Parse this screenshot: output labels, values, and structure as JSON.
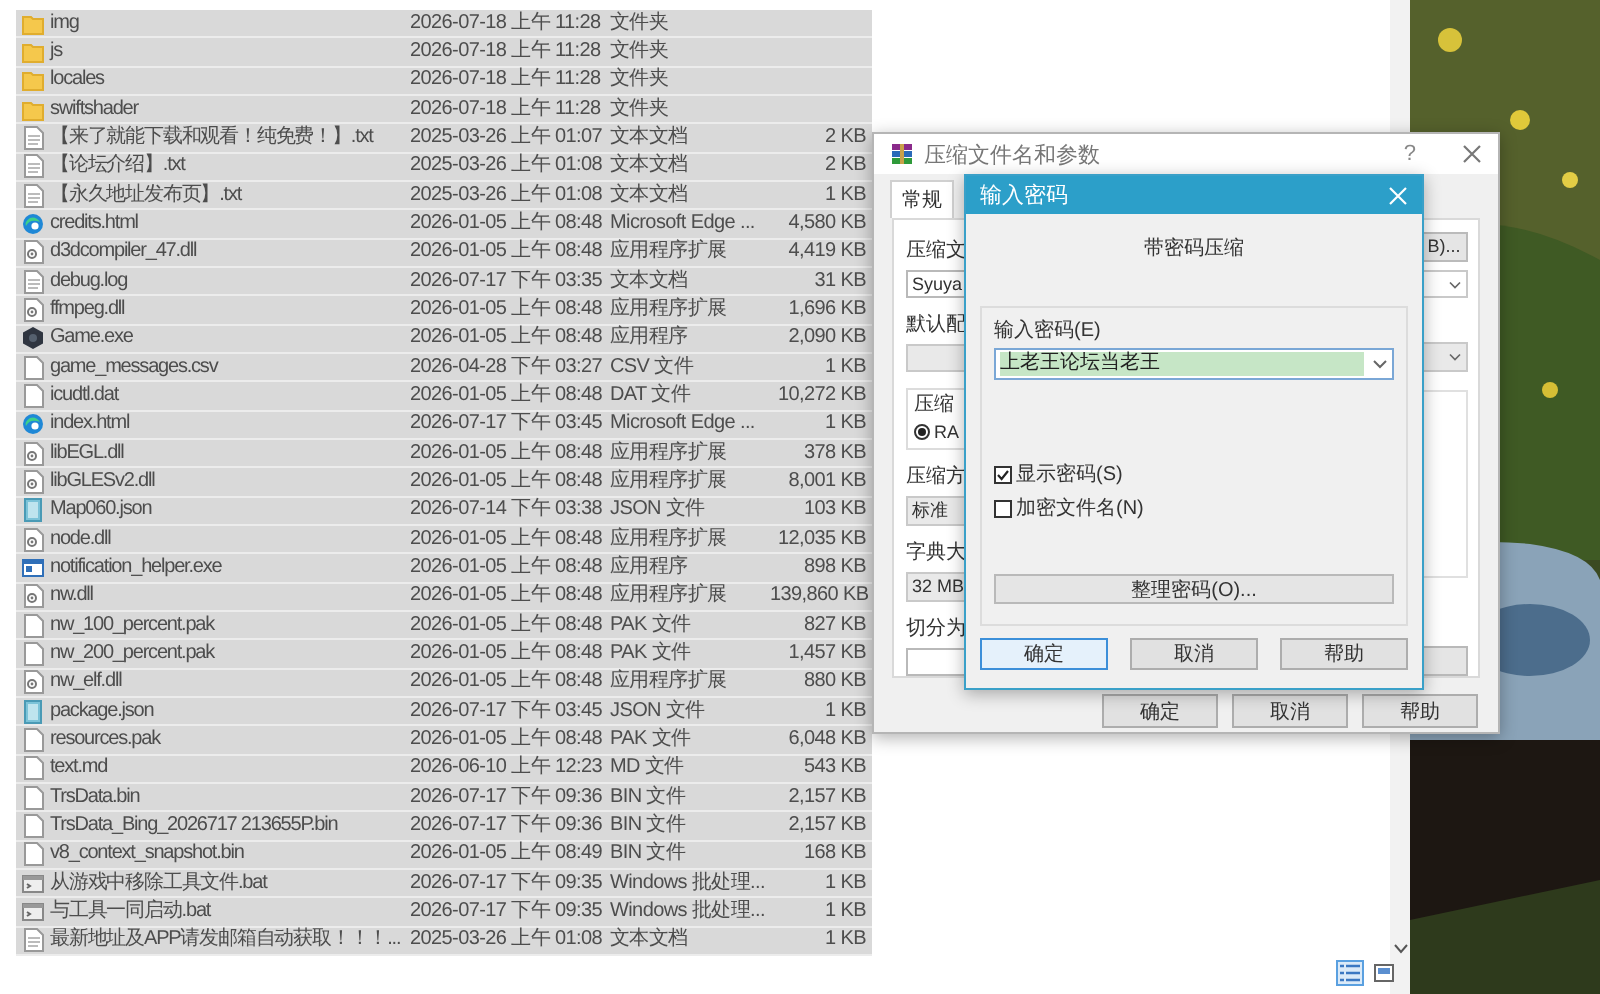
{
  "explorer": {
    "files": [
      {
        "name": "img",
        "date": "2026-07-18 上午 11:28",
        "type": "文件夹",
        "kind": "folder"
      },
      {
        "name": "js",
        "date": "2026-07-18 上午 11:28",
        "type": "文件夹",
        "kind": "folder"
      },
      {
        "name": "locales",
        "date": "2026-07-18 上午 11:28",
        "type": "文件夹",
        "kind": "folder"
      },
      {
        "name": "swiftshader",
        "date": "2026-07-18 上午 11:28",
        "type": "文件夹",
        "kind": "folder"
      },
      {
        "name": "【来了就能下载和观看！纯免费！】.txt",
        "date": "2025-03-26 上午 01:07",
        "type": "文本文档",
        "size": "2 KB",
        "kind": "text"
      },
      {
        "name": "【论坛介绍】.txt",
        "date": "2025-03-26 上午 01:08",
        "type": "文本文档",
        "size": "2 KB",
        "kind": "text"
      },
      {
        "name": "【永久地址发布页】.txt",
        "date": "2025-03-26 上午 01:08",
        "type": "文本文档",
        "size": "1 KB",
        "kind": "text"
      },
      {
        "name": "credits.html",
        "date": "2026-01-05 上午 08:48",
        "type": "Microsoft Edge ...",
        "size": "4,580 KB",
        "kind": "browser"
      },
      {
        "name": "d3dcompiler_47.dll",
        "date": "2026-01-05 上午 08:48",
        "type": "应用程序扩展",
        "size": "4,419 KB",
        "kind": "dll"
      },
      {
        "name": "debug.log",
        "date": "2026-07-17 下午 03:35",
        "type": "文本文档",
        "size": "31 KB",
        "kind": "text"
      },
      {
        "name": "ffmpeg.dll",
        "date": "2026-01-05 上午 08:48",
        "type": "应用程序扩展",
        "size": "1,696 KB",
        "kind": "dll"
      },
      {
        "name": "Game.exe",
        "date": "2026-01-05 上午 08:48",
        "type": "应用程序",
        "size": "2,090 KB",
        "kind": "hexagon"
      },
      {
        "name": "game_messages.csv",
        "date": "2026-04-28 下午 03:27",
        "type": "CSV 文件",
        "size": "1 KB",
        "kind": "blank"
      },
      {
        "name": "icudtl.dat",
        "date": "2026-01-05 上午 08:48",
        "type": "DAT 文件",
        "size": "10,272 KB",
        "kind": "blank"
      },
      {
        "name": "index.html",
        "date": "2026-07-17 下午 03:45",
        "type": "Microsoft Edge ...",
        "size": "1 KB",
        "kind": "browser"
      },
      {
        "name": "libEGL.dll",
        "date": "2026-01-05 上午 08:48",
        "type": "应用程序扩展",
        "size": "378 KB",
        "kind": "dll"
      },
      {
        "name": "libGLESv2.dll",
        "date": "2026-01-05 上午 08:48",
        "type": "应用程序扩展",
        "size": "8,001 KB",
        "kind": "dll"
      },
      {
        "name": "Map060.json",
        "date": "2026-07-14 下午 03:38",
        "type": "JSON 文件",
        "size": "103 KB",
        "kind": "data"
      },
      {
        "name": "node.dll",
        "date": "2026-01-05 上午 08:48",
        "type": "应用程序扩展",
        "size": "12,035 KB",
        "kind": "dll"
      },
      {
        "name": "notification_helper.exe",
        "date": "2026-01-05 上午 08:48",
        "type": "应用程序",
        "size": "898 KB",
        "kind": "app"
      },
      {
        "name": "nw.dll",
        "date": "2026-01-05 上午 08:48",
        "type": "应用程序扩展",
        "size": "139,860 KB",
        "kind": "dll"
      },
      {
        "name": "nw_100_percent.pak",
        "date": "2026-01-05 上午 08:48",
        "type": "PAK 文件",
        "size": "827 KB",
        "kind": "blank"
      },
      {
        "name": "nw_200_percent.pak",
        "date": "2026-01-05 上午 08:48",
        "type": "PAK 文件",
        "size": "1,457 KB",
        "kind": "blank"
      },
      {
        "name": "nw_elf.dll",
        "date": "2026-01-05 上午 08:48",
        "type": "应用程序扩展",
        "size": "880 KB",
        "kind": "dll"
      },
      {
        "name": "package.json",
        "date": "2026-07-17 下午 03:45",
        "type": "JSON 文件",
        "size": "1 KB",
        "kind": "data"
      },
      {
        "name": "resources.pak",
        "date": "2026-01-05 上午 08:48",
        "type": "PAK 文件",
        "size": "6,048 KB",
        "kind": "blank"
      },
      {
        "name": "text.md",
        "date": "2026-06-10 上午 12:23",
        "type": "MD 文件",
        "size": "543 KB",
        "kind": "blank"
      },
      {
        "name": "TrsData.bin",
        "date": "2026-07-17 下午 09:36",
        "type": "BIN 文件",
        "size": "2,157 KB",
        "kind": "blank"
      },
      {
        "name": "TrsData_Bing_2026717 213655P.bin",
        "date": "2026-07-17 下午 09:36",
        "type": "BIN 文件",
        "size": "2,157 KB",
        "kind": "blank"
      },
      {
        "name": "v8_context_snapshot.bin",
        "date": "2026-01-05 上午 08:49",
        "type": "BIN 文件",
        "size": "168 KB",
        "kind": "blank"
      },
      {
        "name": "从游戏中移除工具文件.bat",
        "date": "2026-07-17 下午 09:35",
        "type": "Windows 批处理...",
        "size": "1 KB",
        "kind": "batch"
      },
      {
        "name": "与工具一同启动.bat",
        "date": "2026-07-17 下午 09:35",
        "type": "Windows 批处理...",
        "size": "1 KB",
        "kind": "batch"
      },
      {
        "name": "最新地址及APP请发邮箱自动获取！！！...",
        "date": "2025-03-26 上午 01:08",
        "type": "文本文档",
        "size": "1 KB",
        "kind": "text"
      }
    ],
    "view_buttons": [
      {
        "kind": "details",
        "selected": true
      },
      {
        "kind": "preview",
        "selected": false
      }
    ]
  },
  "archive_dialog": {
    "title": "压缩文件名和参数",
    "help": "?",
    "tabs": [
      {
        "label": "常规",
        "selected": true
      }
    ],
    "archive_name_label": "压缩文",
    "archive_name": "Syuya",
    "browse_button": "B)...",
    "profile_label": "默认配",
    "format_group_label": "压缩",
    "format_options": [
      {
        "label": "RA",
        "selected": true
      }
    ],
    "method_label": "压缩方",
    "method": "标准",
    "dictionary_label": "字典大",
    "dictionary": "32 MB",
    "split_label": "切分为",
    "buttons": [
      "确定",
      "取消",
      "帮助"
    ]
  },
  "password_dialog": {
    "title": "输入密码",
    "heading": "带密码压缩",
    "password_label": "输入密码(E)",
    "password": "上老王论坛当老王",
    "options": [
      {
        "label": "显示密码(S)",
        "checked": true
      },
      {
        "label": "加密文件名(N)",
        "checked": false
      }
    ],
    "organize_button": "整理密码(O)...",
    "buttons": [
      {
        "label": "确定",
        "focused": true
      },
      {
        "label": "取消",
        "focused": false
      },
      {
        "label": "帮助",
        "focused": false
      }
    ]
  }
}
